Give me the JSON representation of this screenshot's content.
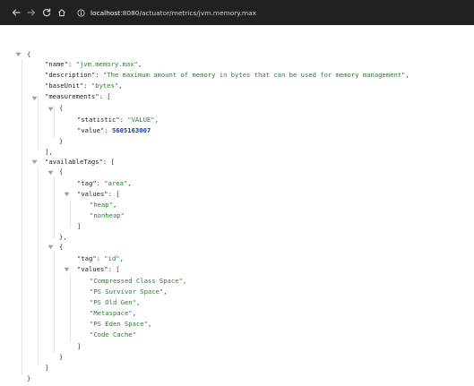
{
  "browser": {
    "url_host": "localhost",
    "url_rest": ":8080/actuator/metrics/jvm.memory.max"
  },
  "json": {
    "name": "jvm.memory.max",
    "description": "The maximum amount of memory in bytes that can be used for memory management",
    "baseUnit": "bytes",
    "measurements": [
      {
        "statistic": "VALUE",
        "value": "5605163007"
      }
    ],
    "availableTags": [
      {
        "tag": "area",
        "values": [
          "heap",
          "nonheap"
        ]
      },
      {
        "tag": "id",
        "values": [
          "Compressed Class Space",
          "PS Survivor Space",
          "PS Old Gen",
          "Metaspace",
          "PS Eden Space",
          "Code Cache"
        ]
      }
    ]
  },
  "keys": {
    "name": "name",
    "description": "description",
    "baseUnit": "baseUnit",
    "measurements": "measurements",
    "statistic": "statistic",
    "value": "value",
    "availableTags": "availableTags",
    "tag": "tag",
    "values": "values"
  },
  "icons": {
    "back": "arrow-left-icon",
    "forward": "arrow-right-icon",
    "reload": "reload-icon",
    "home": "home-icon",
    "site": "site-info-icon",
    "toggle": "collapse-triangle-icon"
  },
  "colors": {
    "toolbar": "#202124",
    "string": "#2e7d32",
    "number": "#1a3fa8"
  }
}
